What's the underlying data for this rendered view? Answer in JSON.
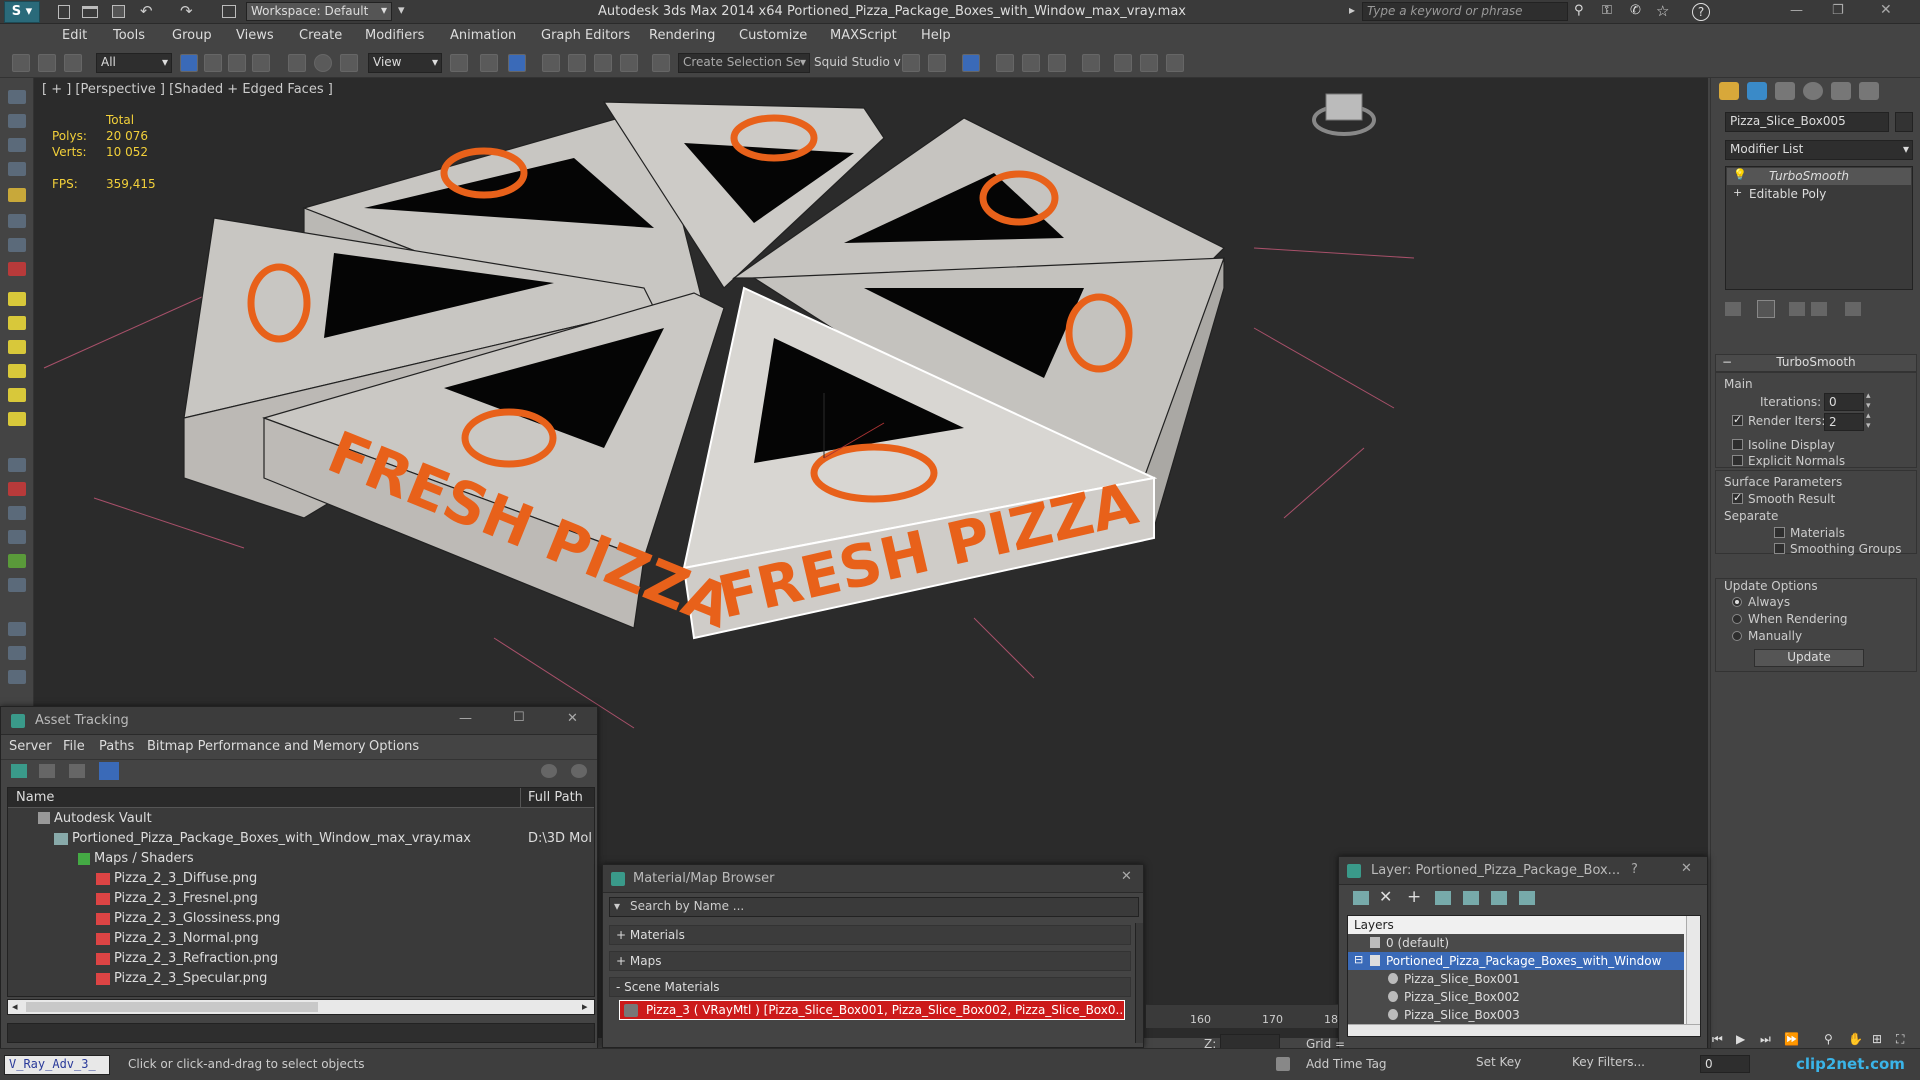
{
  "title": {
    "workspace": "Workspace: Default",
    "app": "Autodesk 3ds Max  2014 x64",
    "file": "Portioned_Pizza_Package_Boxes_with_Window_max_vray.max",
    "search_placeholder": "Type a keyword or phrase"
  },
  "menu": [
    "Edit",
    "Tools",
    "Group",
    "Views",
    "Create",
    "Modifiers",
    "Animation",
    "Graph Editors",
    "Rendering",
    "Customize",
    "MAXScript",
    "Help"
  ],
  "toolbar": {
    "filter": "All",
    "view": "View",
    "selection_set": "Create Selection Se",
    "squid": "Squid Studio v"
  },
  "viewport": {
    "label": "[ + ] [Perspective ] [Shaded + Edged Faces ]",
    "total": "Total",
    "polys_label": "Polys:",
    "polys_value": "20 076",
    "verts_label": "Verts:",
    "verts_value": "10 052",
    "fps_label": "FPS:",
    "fps_value": "359,415",
    "box_text": "FRESH PIZZA"
  },
  "command": {
    "object_name": "Pizza_Slice_Box005",
    "modifier_list": "Modifier List",
    "stack": [
      "TurboSmooth",
      "Editable Poly"
    ],
    "rollout": "TurboSmooth",
    "main": "Main",
    "iterations_label": "Iterations:",
    "iterations_value": "0",
    "render_iters_label": "Render Iters:",
    "render_iters_value": "2",
    "isoline": "Isoline Display",
    "explicit": "Explicit Normals",
    "surface": "Surface Parameters",
    "smooth": "Smooth Result",
    "separate": "Separate",
    "materials": "Materials",
    "smoothing": "Smoothing Groups",
    "update_options": "Update Options",
    "always": "Always",
    "when_rendering": "When Rendering",
    "manually": "Manually",
    "update_btn": "Update"
  },
  "asset": {
    "title": "Asset Tracking",
    "menu": [
      "Server",
      "File",
      "Paths",
      "Bitmap Performance and Memory",
      "Options"
    ],
    "col_name": "Name",
    "col_path": "Full Path",
    "vault": "Autodesk Vault",
    "maxfile": "Portioned_Pizza_Package_Boxes_with_Window_max_vray.max",
    "maxfile_path": "D:\\3D Mol",
    "maps": "Maps / Shaders",
    "files": [
      "Pizza_2_3_Diffuse.png",
      "Pizza_2_3_Fresnel.png",
      "Pizza_2_3_Glossiness.png",
      "Pizza_2_3_Normal.png",
      "Pizza_2_3_Refraction.png",
      "Pizza_2_3_Specular.png"
    ]
  },
  "material": {
    "title": "Material/Map Browser",
    "search": "Search by Name ...",
    "groups": [
      "+ Materials",
      "+ Maps",
      "- Scene Materials"
    ],
    "item": "Pizza_3  ( VRayMtl )  [Pizza_Slice_Box001, Pizza_Slice_Box002, Pizza_Slice_Box0..."
  },
  "layer": {
    "title": "Layer: Portioned_Pizza_Package_Box...",
    "help": "?",
    "header": "Layers",
    "rows": [
      "0 (default)",
      "Portioned_Pizza_Package_Boxes_with_Window",
      "Pizza_Slice_Box001",
      "Pizza_Slice_Box002",
      "Pizza_Slice_Box003"
    ]
  },
  "timeline": {
    "t160": "160",
    "t170": "170",
    "t18": "18"
  },
  "status": {
    "script": "V_Ray_Adv_3_",
    "prompt": "Click or click-and-drag to select objects",
    "add_time_tag": "Add Time Tag",
    "set_key": "Set Key",
    "key_filters": "Key Filters...",
    "frame": "0",
    "z_label": "Z:",
    "grid_label": "Grid =",
    "watermark": "clip2net.com"
  },
  "colors": {
    "accent": "#e8611a",
    "selection": "#3a6ab8",
    "highlight_red": "#cc1a1a"
  }
}
